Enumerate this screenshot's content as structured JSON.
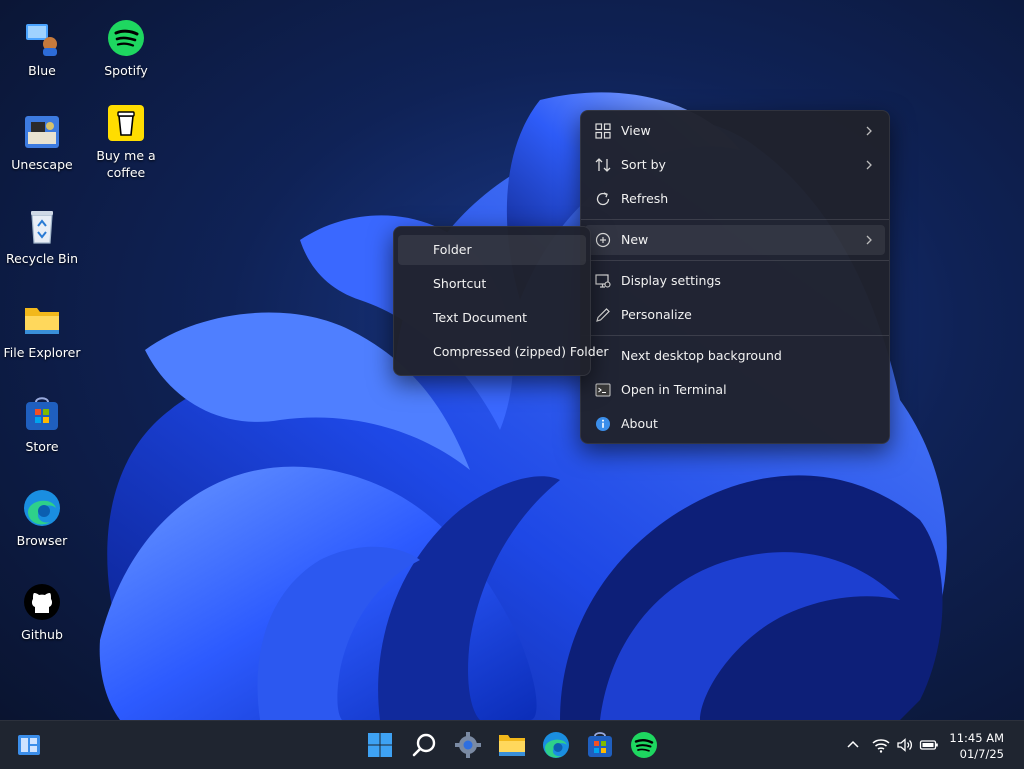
{
  "desktop": {
    "icons": [
      {
        "label": "Blue",
        "icon": "blue-app-icon"
      },
      {
        "label": "Spotify",
        "icon": "spotify-icon"
      },
      {
        "label": "Unescape",
        "icon": "unescape-icon"
      },
      {
        "label": "Buy me a coffee",
        "icon": "coffee-cup-icon"
      },
      {
        "label": "Recycle Bin",
        "icon": "recycle-bin-icon"
      },
      {
        "label": "File Explorer",
        "icon": "folder-icon"
      },
      {
        "label": "Store",
        "icon": "store-icon"
      },
      {
        "label": "Browser",
        "icon": "edge-browser-icon"
      },
      {
        "label": "Github",
        "icon": "github-icon"
      }
    ]
  },
  "context_menu": {
    "items": [
      {
        "label": "View",
        "icon": "grid-icon",
        "submenu": true
      },
      {
        "label": "Sort by",
        "icon": "sort-arrows-icon",
        "submenu": true
      },
      {
        "label": "Refresh",
        "icon": "refresh-icon"
      },
      {
        "label": "New",
        "icon": "plus-circle-icon",
        "submenu": true,
        "highlighted": true
      },
      {
        "label": "Display settings",
        "icon": "display-settings-icon"
      },
      {
        "label": "Personalize",
        "icon": "pen-icon"
      },
      {
        "label": "Next desktop background"
      },
      {
        "label": "Open in Terminal",
        "icon": "terminal-icon"
      },
      {
        "label": "About",
        "icon": "info-icon"
      }
    ]
  },
  "new_submenu": {
    "items": [
      {
        "label": "Folder",
        "highlighted": true
      },
      {
        "label": "Shortcut"
      },
      {
        "label": "Text Document"
      },
      {
        "label": "Compressed (zipped) Folder"
      }
    ]
  },
  "taskbar": {
    "apps": [
      "widgets-icon",
      "start-windows-icon",
      "search-icon",
      "settings-gear-icon",
      "file-explorer-icon",
      "edge-browser-icon",
      "store-icon",
      "spotify-icon"
    ],
    "tray": [
      "chevron-up-icon",
      "wifi-icon",
      "volume-icon",
      "battery-icon"
    ],
    "time": "11:45 AM",
    "date": "01/7/25"
  },
  "colors": {
    "accent": "#2f6bff",
    "menu_bg": "#20222c",
    "taskbar_bg": "#1f2530",
    "spotify": "#1ed760"
  }
}
